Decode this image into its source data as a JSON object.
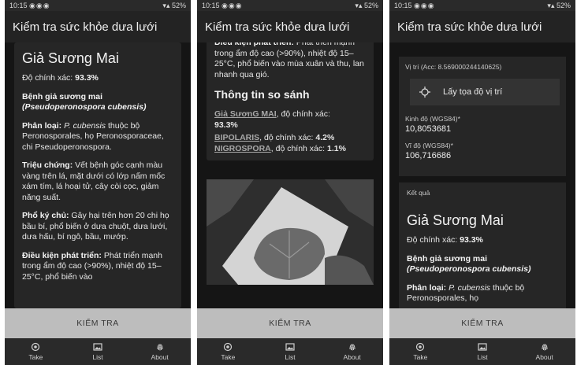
{
  "status": {
    "time": "10:15",
    "battery": "52%"
  },
  "app_title": "Kiểm tra sức khỏe dưa lưới",
  "result": {
    "disease_name": "Giả Sương Mai",
    "accuracy_label": "Độ chính xác:",
    "accuracy_value": "93.3%",
    "pathogen_name": "Bệnh giả sương mai",
    "pathogen_scientific": "(Pseudoperonospora cubensis)",
    "classification_label": "Phân loại:",
    "classification_species": "P. cubensis",
    "classification_text": " thuộc bộ Peronosporales, họ Peronosporaceae, chi Pseudoperonospora.",
    "symptoms_label": "Triệu chứng:",
    "symptoms_text": " Vết bệnh góc cạnh màu vàng trên lá, mặt dưới có lớp nấm mốc xám tím, lá hoại tử, cây còi cọc, giảm năng suất.",
    "host_label": "Phổ ký chủ:",
    "host_text": " Gây hại trên hơn 20 chi họ bầu bí, phổ biến ở dưa chuột, dưa lưới, dưa hấu, bí ngô, bầu, mướp.",
    "conditions_label": "Điều kiện phát triển:",
    "conditions_text": " Phát triển mạnh trong ẩm độ cao (>90%), nhiệt độ 15–25°C, phổ biến vào mùa xuân và thu, lan nhanh qua gió.",
    "conditions_text_cut": " Phát triển mạnh trong ẩm độ cao (>90%), nhiệt độ 15–25°C, phổ biến vào"
  },
  "comparison": {
    "title": "Thông tin so sánh",
    "items": [
      {
        "name": "Giả SươnG MAI",
        "label": ", độ chính xác:",
        "value": "93.3%"
      },
      {
        "name": "BIPOLARIS",
        "label": ", độ chính xác:",
        "value": "4.2%"
      },
      {
        "name": "NIGROSPORA",
        "label": ", độ chính xác:",
        "value": "1.1%"
      }
    ]
  },
  "location": {
    "header": "Vị trí (Acc: 8.569000244140625)",
    "get_button": "Lấy tọa độ vị trí",
    "lon_label": "Kinh độ (WGS84)*",
    "lon_value": "10,8053681",
    "lat_label": "Vĩ độ (WGS84)*",
    "lat_value": "106,716686"
  },
  "result_header": "Kết quả",
  "classification_cut": " thuộc bộ Peronosporales, họ",
  "check_button": "KIỂM TRA",
  "nav": [
    {
      "label": "Take",
      "icon": "camera-icon"
    },
    {
      "label": "List",
      "icon": "gallery-icon"
    },
    {
      "label": "About",
      "icon": "fingerprint-icon"
    }
  ]
}
